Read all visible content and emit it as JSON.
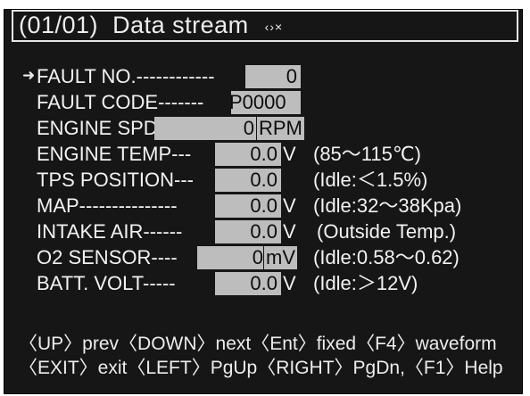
{
  "header": {
    "page": "(01/01)",
    "title": "Data stream",
    "nav_icons": "‹›×"
  },
  "rows": [
    {
      "label": "FAULT NO.------------",
      "value": "0",
      "unit": "",
      "range": ""
    },
    {
      "label": "FAULT CODE-------",
      "value": "P0000",
      "unit": "",
      "range": ""
    },
    {
      "label": "ENGINE SPD--",
      "value": "0",
      "unit": "RPM",
      "range": ""
    },
    {
      "label": "ENGINE TEMP---",
      "value": "0.0",
      "unit": "V",
      "range": "(85～115℃)"
    },
    {
      "label": "TPS POSITION---",
      "value": "0.0",
      "unit": "",
      "range": "(Idle:＜1.5%)"
    },
    {
      "label": "MAP---------------",
      "value": "0.0",
      "unit": "V",
      "range": "(Idle:32～38Kpa)"
    },
    {
      "label": "INTAKE AIR------",
      "value": "0.0",
      "unit": "V",
      "range": "(Outside Temp.)"
    },
    {
      "label": "O2 SENSOR----",
      "value": "0",
      "unit": "mV",
      "range": "(Idle:0.58～0.62)"
    },
    {
      "label": "BATT. VOLT-----",
      "value": "0.0",
      "unit": "V",
      "range": "(Idle:＞12V)"
    }
  ],
  "footer": {
    "line1": "〈UP〉prev〈DOWN〉next〈Ent〉fixed〈F4〉waveform",
    "line2": "〈EXIT〉exit〈LEFT〉PgUp〈RIGHT〉PgDn,〈F1〉Help"
  }
}
